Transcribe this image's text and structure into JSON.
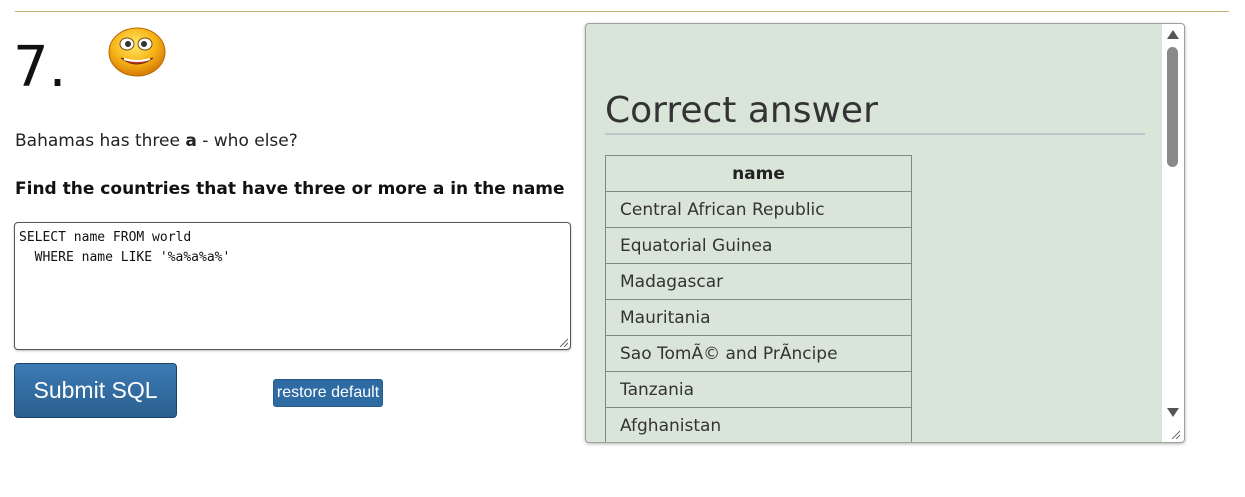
{
  "question": {
    "number": "7.",
    "smiley_icon": "smiley-face-icon",
    "intro_prefix": "Bahamas has three ",
    "intro_bold": "a",
    "intro_suffix": " - who else?",
    "task": "Find the countries that have three or more a in the name"
  },
  "editor": {
    "sql": "SELECT name FROM world\n  WHERE name LIKE '%a%a%a%'"
  },
  "buttons": {
    "submit_label": "Submit SQL",
    "restore_label": "restore default"
  },
  "answer": {
    "title": "Correct answer",
    "column_header": "name",
    "rows": [
      "Central African Republic",
      "Equatorial Guinea",
      "Madagascar",
      "Mauritania",
      "Sao TomÃ© and PrÃ­ncipe",
      "Tanzania",
      "Afghanistan"
    ]
  },
  "colors": {
    "panel_bg": "#dae5da",
    "button_blue": "#2f6ba3",
    "rule_gold": "#c8b27a"
  }
}
